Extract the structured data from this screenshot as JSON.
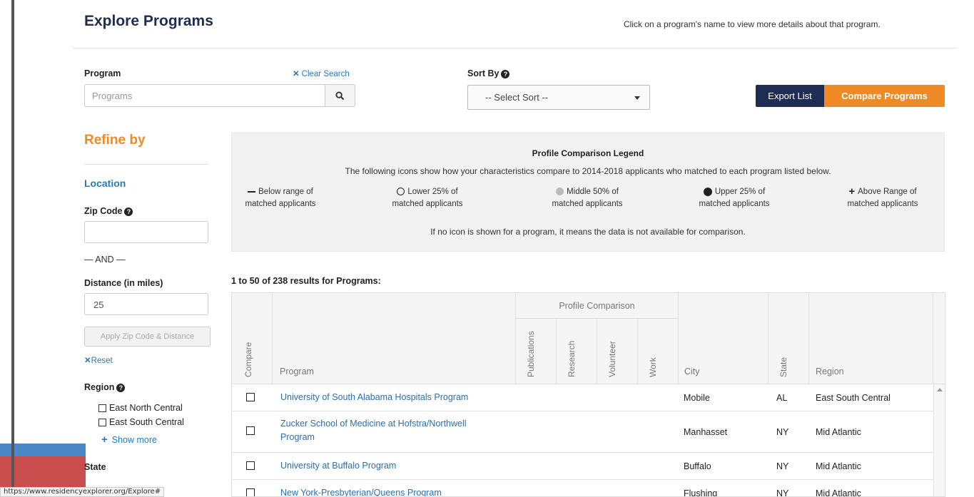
{
  "header": {
    "title": "Explore Programs",
    "hint": "Click on a program's name to view more details about that program."
  },
  "search": {
    "program_label": "Program",
    "clear_label": "Clear Search",
    "placeholder": "Programs",
    "sort_label": "Sort By",
    "sort_value": "-- Select Sort --",
    "export_label": "Export List",
    "compare_label": "Compare Programs"
  },
  "sidebar": {
    "refine_title": "Refine by",
    "location_title": "Location",
    "zip_label": "Zip Code",
    "and_label": "— AND —",
    "distance_label": "Distance (in miles)",
    "distance_value": "25",
    "apply_label": "Apply Zip Code & Distance",
    "reset_label": "Reset",
    "region_label": "Region",
    "regions": [
      "East North Central",
      "East South Central"
    ],
    "show_more_label": "Show more",
    "state_label": "State"
  },
  "legend": {
    "title": "Profile Comparison Legend",
    "description": "The following icons show how your characteristics compare to 2014-2018 applicants who matched to each program listed below.",
    "items": [
      {
        "line1": "Below range of",
        "line2": "matched applicants",
        "icon": "dash-icon"
      },
      {
        "line1": "Lower 25% of",
        "line2": "matched applicants",
        "icon": "open-circle-icon"
      },
      {
        "line1": "Middle 50% of",
        "line2": "matched applicants",
        "icon": "gray-circle-icon"
      },
      {
        "line1": "Upper 25% of",
        "line2": "matched applicants",
        "icon": "filled-circle-icon"
      },
      {
        "line1": "Above Range of",
        "line2": "matched applicants",
        "icon": "plus-icon"
      }
    ],
    "note": "If no icon is shown for a program, it means the data is not available for comparison."
  },
  "results": {
    "summary": "1 to 50 of 238 results for Programs:",
    "headers": {
      "compare": "Compare",
      "program": "Program",
      "profile_comparison": "Profile Comparison",
      "publications": "Publications",
      "research": "Research",
      "volunteer": "Volunteer",
      "work": "Work",
      "city": "City",
      "state": "State",
      "region": "Region"
    },
    "rows": [
      {
        "program": "University of South Alabama Hospitals Program",
        "program_line2": "",
        "city": "Mobile",
        "state": "AL",
        "region": "East South Central"
      },
      {
        "program": "Zucker School of Medicine at Hofstra/Northwell",
        "program_line2": "Program",
        "city": "Manhasset",
        "state": "NY",
        "region": "Mid Atlantic"
      },
      {
        "program": "University at Buffalo Program",
        "program_line2": "",
        "city": "Buffalo",
        "state": "NY",
        "region": "Mid Atlantic"
      },
      {
        "program": "New York-Presbyterian/Queens Program",
        "program_line2": "",
        "city": "Flushing",
        "state": "NY",
        "region": "Mid Atlantic"
      }
    ]
  },
  "status_bar": {
    "url": "https://www.residencyexplorer.org/Explore#"
  },
  "colors": {
    "navy": "#1f2d53",
    "orange": "#f08a24",
    "link_blue": "#2a7ab8"
  }
}
